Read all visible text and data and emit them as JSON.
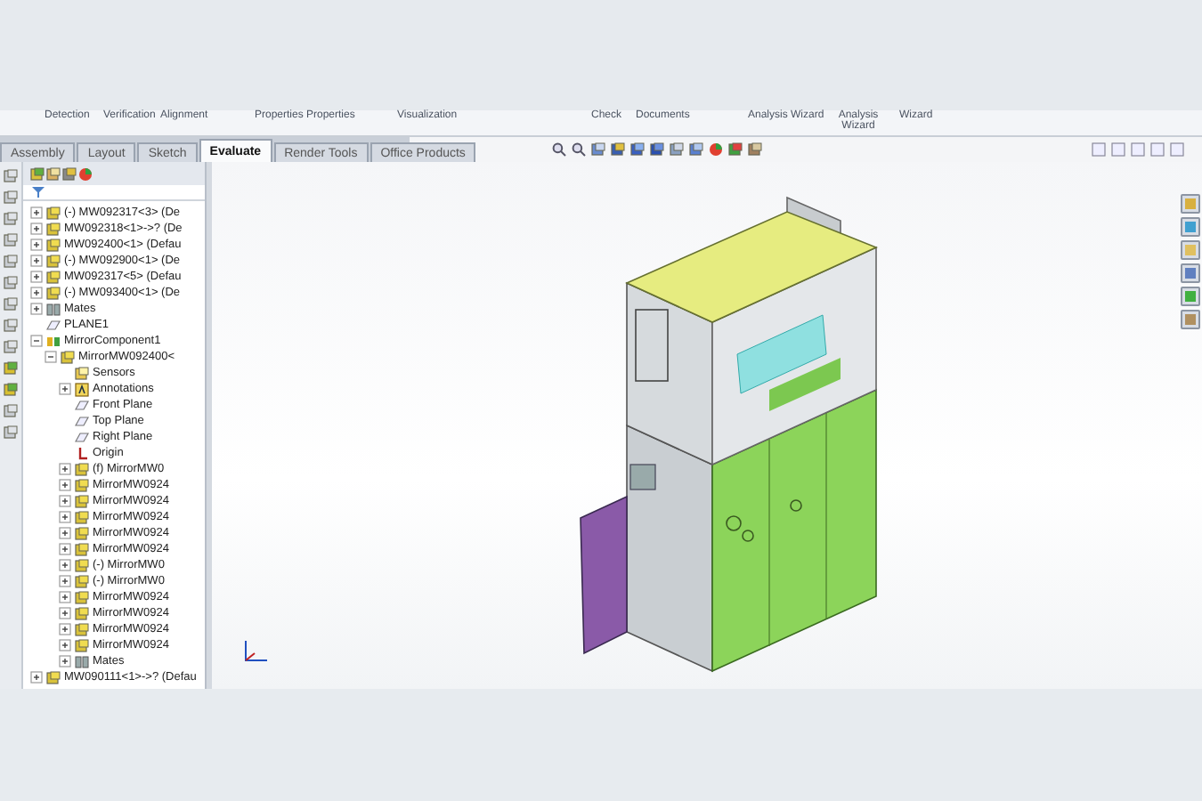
{
  "ribbon": [
    "Detection",
    "Verification",
    "Alignment",
    "Properties",
    "Properties",
    "Visualization",
    "Check",
    "Documents",
    "Analysis Wizard",
    "Analysis Wizard",
    "Wizard"
  ],
  "tabs": [
    {
      "label": "Assembly",
      "selected": false
    },
    {
      "label": "Layout",
      "selected": false
    },
    {
      "label": "Sketch",
      "selected": false
    },
    {
      "label": "Evaluate",
      "selected": true
    },
    {
      "label": "Render Tools",
      "selected": false
    },
    {
      "label": "Office Products",
      "selected": false
    }
  ],
  "tree": [
    {
      "kind": "part",
      "label": "(-) MW092317<3> (De",
      "expanded": false
    },
    {
      "kind": "part",
      "label": "MW092318<1>->? (De",
      "expanded": false
    },
    {
      "kind": "part",
      "label": "MW092400<1> (Defau",
      "expanded": false
    },
    {
      "kind": "part",
      "label": "(-) MW092900<1> (De",
      "expanded": false
    },
    {
      "kind": "part",
      "label": "MW092317<5> (Defau",
      "expanded": false
    },
    {
      "kind": "part",
      "label": "(-) MW093400<1> (De",
      "expanded": false
    },
    {
      "kind": "mates",
      "label": "Mates",
      "expanded": false
    },
    {
      "kind": "plane",
      "label": "PLANE1"
    },
    {
      "kind": "mirror",
      "label": "MirrorComponent1",
      "expanded": true,
      "children": [
        {
          "kind": "part",
          "label": "MirrorMW092400<",
          "expanded": true,
          "children": [
            {
              "kind": "sensors",
              "label": "Sensors"
            },
            {
              "kind": "annotations",
              "label": "Annotations",
              "expanded": false
            },
            {
              "kind": "plane",
              "label": "Front Plane"
            },
            {
              "kind": "plane",
              "label": "Top Plane"
            },
            {
              "kind": "plane",
              "label": "Right Plane"
            },
            {
              "kind": "origin",
              "label": "Origin"
            },
            {
              "kind": "part",
              "label": "(f) MirrorMW0",
              "expanded": false
            },
            {
              "kind": "part",
              "label": "MirrorMW0924",
              "expanded": false
            },
            {
              "kind": "part",
              "label": "MirrorMW0924",
              "expanded": false
            },
            {
              "kind": "part",
              "label": "MirrorMW0924",
              "expanded": false
            },
            {
              "kind": "part",
              "label": "MirrorMW0924",
              "expanded": false
            },
            {
              "kind": "part",
              "label": "MirrorMW0924",
              "expanded": false
            },
            {
              "kind": "part",
              "label": "(-) MirrorMW0",
              "expanded": false
            },
            {
              "kind": "part",
              "label": "(-) MirrorMW0",
              "expanded": false
            },
            {
              "kind": "part",
              "label": "MirrorMW0924",
              "expanded": false
            },
            {
              "kind": "part",
              "label": "MirrorMW0924",
              "expanded": false
            },
            {
              "kind": "part",
              "label": "MirrorMW0924",
              "expanded": false
            },
            {
              "kind": "part",
              "label": "MirrorMW0924",
              "expanded": false
            },
            {
              "kind": "mates",
              "label": "Mates",
              "expanded": false
            }
          ]
        }
      ]
    },
    {
      "kind": "part",
      "label": "MW090111<1>->? (Defau",
      "expanded": false
    }
  ]
}
